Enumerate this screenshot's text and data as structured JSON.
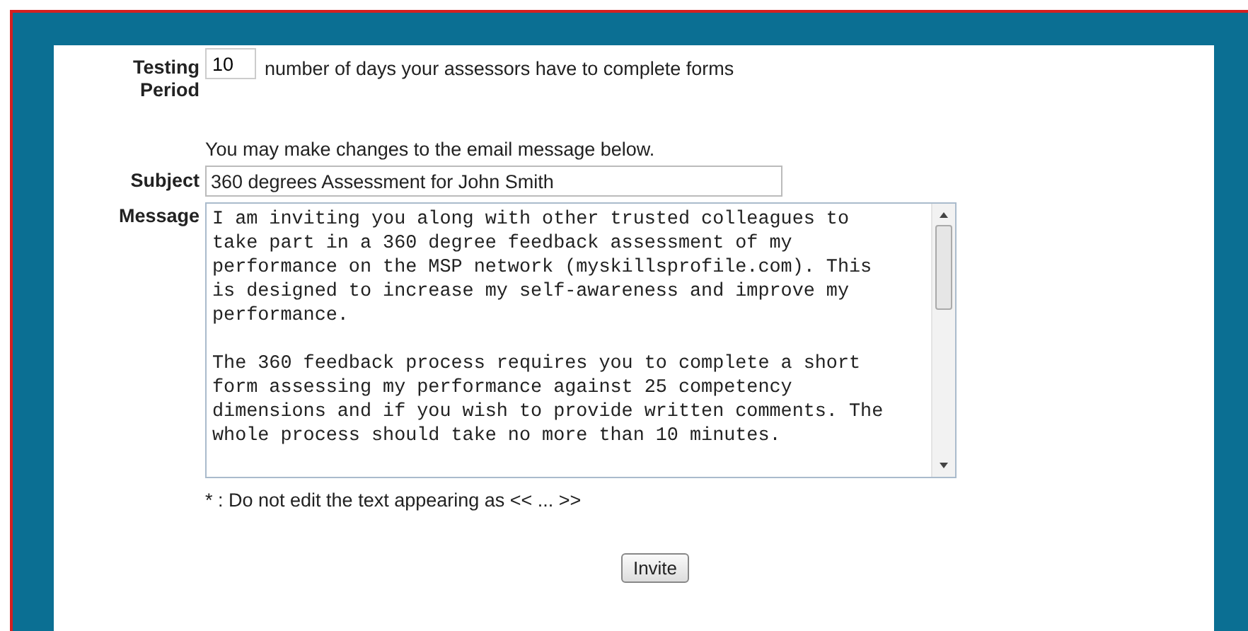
{
  "testing_period": {
    "label_lines": [
      "Testing",
      "Period"
    ],
    "value": "10",
    "hint": "number of days your assessors have to complete forms"
  },
  "intro": "You may make changes to the email message below.",
  "subject": {
    "label": "Subject",
    "value": "360 degrees Assessment for John Smith"
  },
  "message": {
    "label": "Message",
    "paragraphs": [
      [
        "I am inviting you along with other trusted colleagues to",
        "take part in a 360 degree feedback assessment of my",
        "performance on the MSP network (myskillsprofile.com). This",
        "is designed to increase my self-awareness and improve my",
        "performance."
      ],
      [
        "The 360 feedback process requires you to complete a short",
        "form assessing my performance against 25 competency",
        "dimensions and if you wish to provide written comments. The",
        "whole process should take no more than 10 minutes."
      ]
    ]
  },
  "note": "* : Do not edit the text appearing as << ... >>",
  "buttons": [
    "Invite"
  ]
}
